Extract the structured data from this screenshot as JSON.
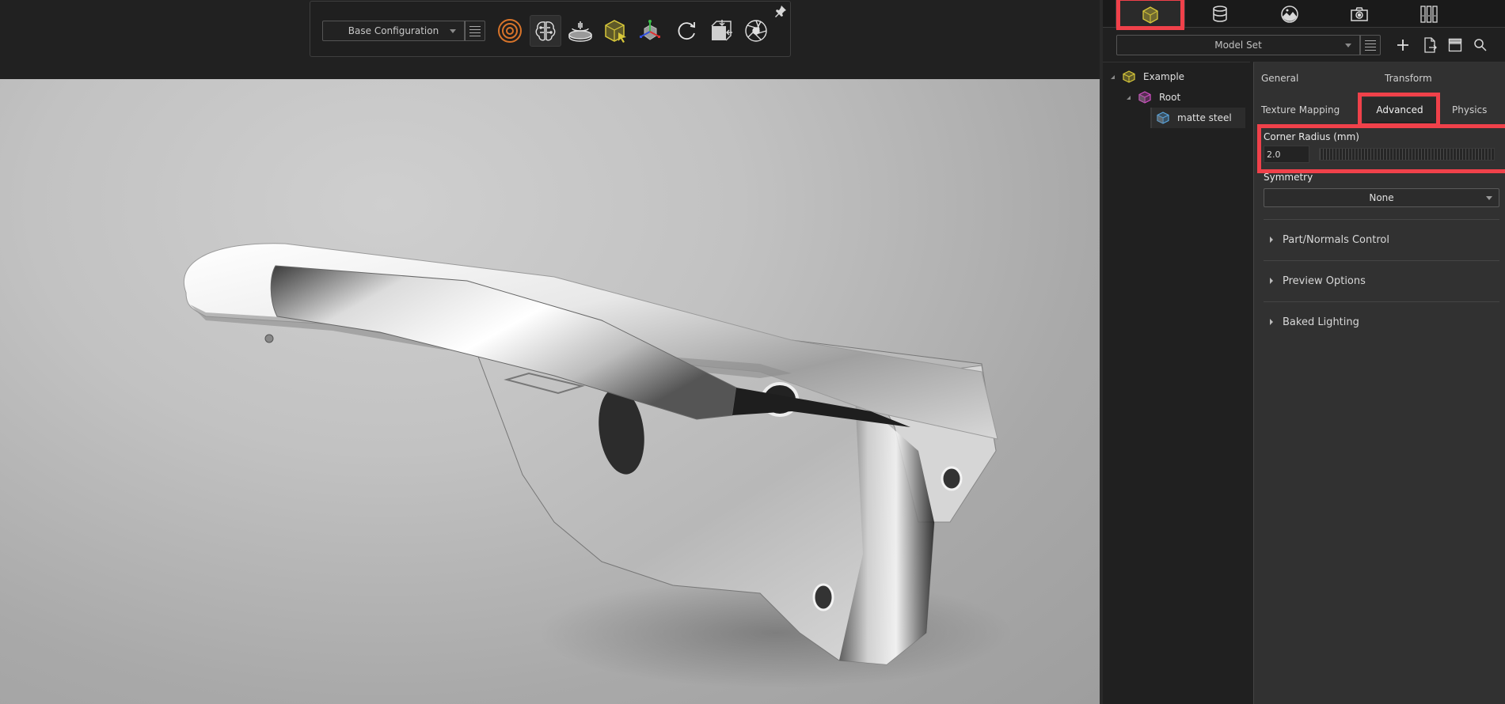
{
  "toolbar": {
    "configuration": "Base Configuration",
    "icons": [
      "render-mode-icon",
      "ai-brain-icon",
      "turntable-icon",
      "select-object-icon",
      "axis-gizmo-icon",
      "reset-view-icon",
      "fit-to-view-icon",
      "camera-aperture-icon"
    ],
    "active_icon": "ai-brain-icon",
    "pinned": true
  },
  "panel": {
    "tabs": [
      "models-tab",
      "materials-tab",
      "environment-tab",
      "cameras-tab",
      "libraries-tab"
    ],
    "active_tab": "models-tab",
    "model_set": "Model Set",
    "tools": [
      "add-icon",
      "import-icon",
      "layout-icon",
      "search-icon"
    ]
  },
  "tree": {
    "items": [
      {
        "label": "Example",
        "level": 0,
        "expanded": true
      },
      {
        "label": "Root",
        "level": 1,
        "expanded": true
      },
      {
        "label": "matte steel",
        "level": 2,
        "selected": true
      }
    ]
  },
  "properties": {
    "tabs": {
      "general": "General",
      "transform": "Transform",
      "texture_mapping": "Texture Mapping",
      "advanced": "Advanced",
      "physics": "Physics"
    },
    "active_tab": "Advanced",
    "corner_radius": {
      "label": "Corner Radius (mm)",
      "value": "2.0"
    },
    "symmetry": {
      "label": "Symmetry",
      "value": "None"
    },
    "sections": [
      "Part/Normals Control",
      "Preview Options",
      "Baked Lighting"
    ]
  },
  "colors": {
    "highlight": "#f0414a",
    "model_icon": "#d8c83a",
    "root_icon": "#d44fc6",
    "part_icon": "#5aa6e0",
    "render_icon": "#d8742a"
  }
}
